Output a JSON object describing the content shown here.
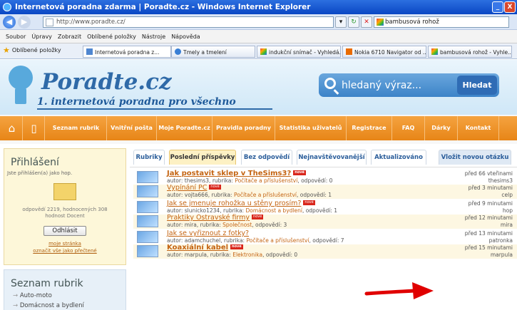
{
  "window": {
    "title": "Internetová poradna zdarma | Poradte.cz - Windows Internet Explorer",
    "minimize": "_",
    "close": "X"
  },
  "browser": {
    "url": "http://www.poradte.cz/",
    "search_value": "bambusová rohož",
    "menu": [
      "Soubor",
      "Úpravy",
      "Zobrazit",
      "Oblíbené položky",
      "Nástroje",
      "Nápověda"
    ],
    "favorites_label": "Oblíbené položky",
    "tabs": [
      {
        "label": "Internetová poradna z...",
        "active": true
      },
      {
        "label": "Tmely a tmelení"
      },
      {
        "label": "indukční snímač - Vyhledá..."
      },
      {
        "label": "Nokia 6710 Navigator od ..."
      },
      {
        "label": "bambusová rohož - Vyhle..."
      }
    ]
  },
  "header": {
    "brand": "Poradte.cz",
    "tagline": "1. internetová poradna pro všechno",
    "search_placeholder": "hledaný výraz...",
    "search_button": "Hledat"
  },
  "nav": {
    "items": [
      "Seznam rubrik",
      "Vnitřní pošta",
      "Moje Poradte.cz",
      "Pravidla poradny",
      "Statistika uživatelů",
      "Registrace",
      "FAQ",
      "Dárky",
      "Kontakt"
    ]
  },
  "login": {
    "heading": "Přihlášení",
    "logged_in_as": "Jste přihlášen(a) jako hop.",
    "stats_line1": "odpovědí 2219, hodnocených 308",
    "stats_line2": "hodnost Docent",
    "logout": "Odhlásit",
    "my_page": "moje stránka",
    "mark_read": "označit vše jako přečtené"
  },
  "rubriky": {
    "heading": "Seznam rubrik",
    "items": [
      "Auto-moto",
      "Domácnost a bydlení"
    ]
  },
  "content_tabs": {
    "tabs": [
      "Rubriky",
      "Poslední příspěvky",
      "Bez odpovědí",
      "Nejnavštěvovanější",
      "Aktualizováno"
    ],
    "ask": "Vložit novou otázku"
  },
  "badge_label": "nové",
  "posts": [
    {
      "title": "Jak postavit sklep v TheSims3?",
      "new": true,
      "bold": true,
      "author": "thesims3",
      "rubrika": "Počítače a příslušenství",
      "answers": "0",
      "time": "před 66 vteřinami",
      "user": "thesims3"
    },
    {
      "title": "Vypínání PC",
      "new": true,
      "bold": false,
      "author": "vojta666",
      "rubrika": "Počítače a příslušenství",
      "answers": "1",
      "time": "před 3 minutami",
      "user": "celp"
    },
    {
      "title": "Jak se jmenuje rohožka u stěny prosím?",
      "new": true,
      "bold": false,
      "author": "slunicko1234",
      "rubrika": "Domácnost a bydlení",
      "answers": "1",
      "time": "před 9 minutami",
      "user": "hop"
    },
    {
      "title": "Praktiky Ostravské firmy",
      "new": true,
      "bold": false,
      "author": "mira",
      "rubrika": "Společnost",
      "answers": "3",
      "time": "před 12 minutami",
      "user": "mira"
    },
    {
      "title": "Jak se vyřiznout z fotky?",
      "new": false,
      "bold": false,
      "author": "adamchuchel",
      "rubrika": "Počítače a příslušenství",
      "answers": "7",
      "time": "před 13 minutami",
      "user": "patronka"
    },
    {
      "title": "Koaxiální kabel",
      "new": true,
      "bold": true,
      "author": "marpula",
      "rubrika": "Elektronika",
      "answers": "0",
      "time": "před 15 minutami",
      "user": "marpula"
    }
  ],
  "meta_labels": {
    "author": "autor: ",
    "rubrika": ", rubrika: ",
    "answers": ", odpovědí: "
  },
  "colors": {
    "nav": "#e78517",
    "accent": "#2f6aa8",
    "link": "#c46412",
    "annotation_arrow": "#e00000"
  }
}
